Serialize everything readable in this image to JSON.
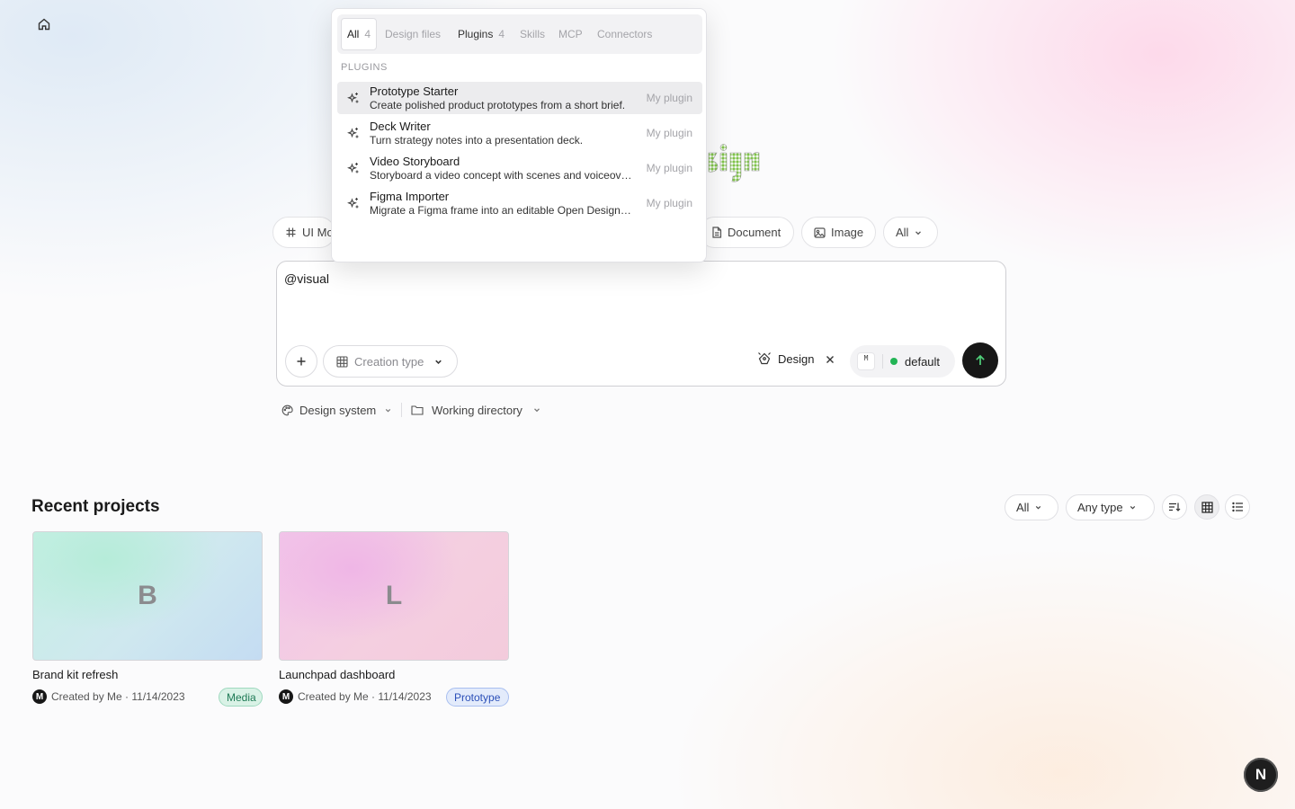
{
  "creation_chips": {
    "ui_mockup": "UI Mo",
    "document": "Document",
    "image": "Image",
    "all": "All"
  },
  "prompt": {
    "text": "@visual",
    "creation_type_label": "Creation type",
    "design_tag_label": "Design",
    "model_badge": "M",
    "model_label": "default",
    "model_status_color": "#22b455"
  },
  "sub_controls": {
    "design_system_label": "Design system",
    "working_directory_label": "Working directory"
  },
  "recent": {
    "title": "Recent projects",
    "filter_scope": "All",
    "filter_type": "Any type",
    "projects": [
      {
        "initial": "B",
        "name": "Brand kit refresh",
        "avatar": "M",
        "meta": "Created by Me · 11/14/2023",
        "type": "Media",
        "type_color": "#1e7a55",
        "type_bg": "#d9f2e6"
      },
      {
        "initial": "L",
        "name": "Launchpad dashboard",
        "avatar": "M",
        "meta": "Created by Me · 11/14/2023",
        "type": "Prototype",
        "type_color": "#2b4fb8",
        "type_bg": "#e3ebfb"
      }
    ]
  },
  "corner_button": {
    "label": "N"
  },
  "mention_popover": {
    "tabs": [
      {
        "label": "All",
        "count": "4"
      },
      {
        "label": "Design files",
        "count": ""
      },
      {
        "label": "Plugins",
        "count": "4"
      },
      {
        "label": "Skills",
        "count": ""
      },
      {
        "label": "MCP",
        "count": ""
      },
      {
        "label": "Connectors",
        "count": ""
      }
    ],
    "section_label": "PLUGINS",
    "items": [
      {
        "title": "Prototype Starter",
        "description": "Create polished product prototypes from a short brief.",
        "tag": "My plugin"
      },
      {
        "title": "Deck Writer",
        "description": "Turn strategy notes into a presentation deck.",
        "tag": "My plugin"
      },
      {
        "title": "Video Storyboard",
        "description": "Storyboard a video concept with scenes and voiceover.",
        "tag": "My plugin"
      },
      {
        "title": "Figma Importer",
        "description": "Migrate a Figma frame into an editable Open Design project.",
        "tag": "My plugin"
      }
    ]
  }
}
